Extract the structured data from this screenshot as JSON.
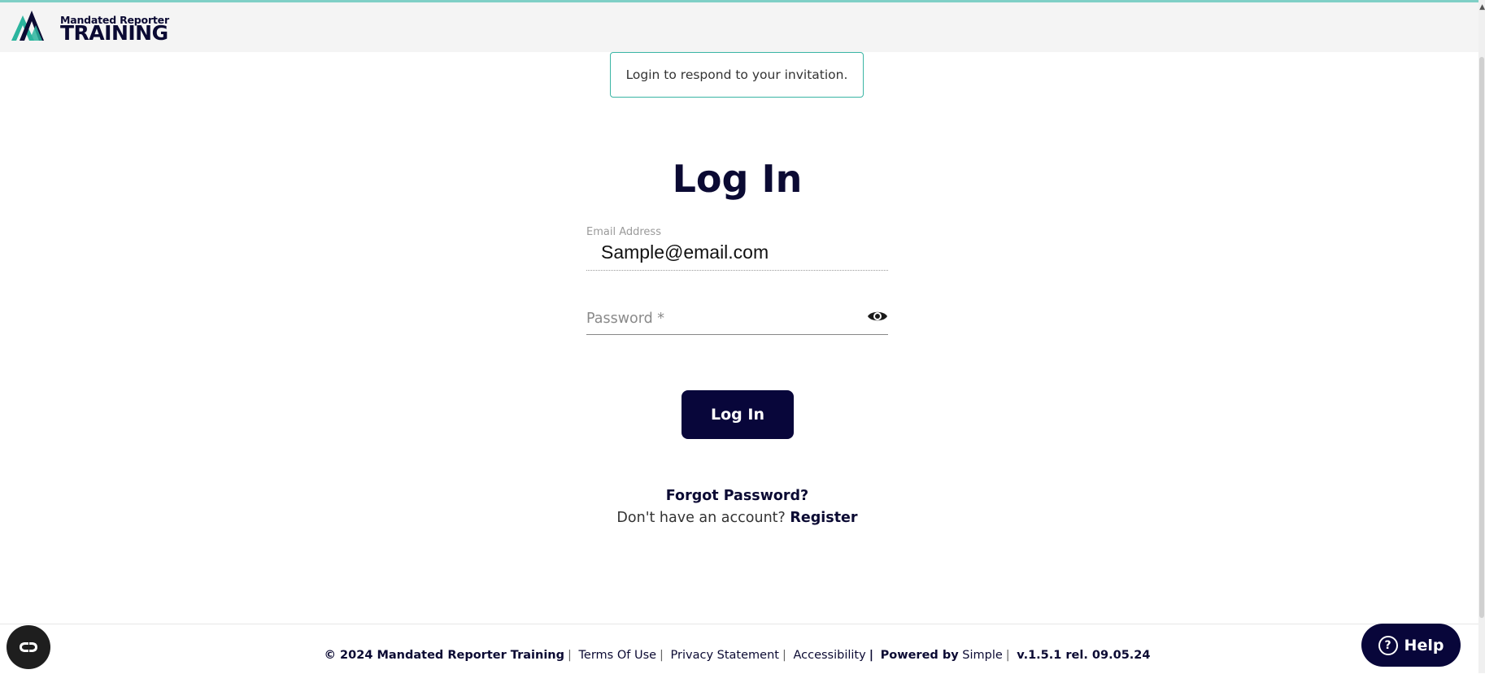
{
  "header": {
    "logo_small": "Mandated Reporter",
    "logo_big": "TRAINING",
    "accent_color": "#7fcfc6",
    "logo_teal": "#2bb59e"
  },
  "notice": {
    "text": "Login to respond to your invitation."
  },
  "login": {
    "title": "Log In",
    "email_label": "Email Address",
    "email_value": "Sample@email.com",
    "password_placeholder": "Password *",
    "password_toggle_icon": "eye-icon",
    "submit_label": "Log In",
    "forgot_link": "Forgot Password?",
    "no_account_text": "Don't have an account?",
    "register_link": "Register"
  },
  "footer": {
    "copyright": "© 2024 Mandated Reporter Training",
    "terms": "Terms Of Use",
    "privacy": "Privacy Statement",
    "accessibility": "Accessibility",
    "powered_by": "Powered by",
    "powered_by_link": "Simple",
    "version": "v.1.5.1 rel. 09.05.24"
  },
  "widgets": {
    "accessibility_icon": "accessibility-icon",
    "help_label": "Help",
    "help_icon": "question-icon"
  },
  "colors": {
    "primary": "#08063a",
    "teal": "#3ab5a4"
  }
}
